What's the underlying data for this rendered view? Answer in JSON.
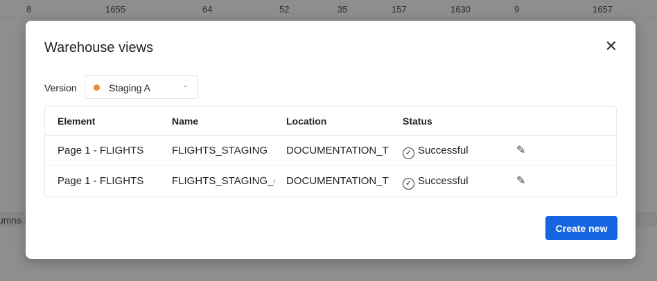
{
  "background": {
    "row_values": [
      "8",
      "1655",
      "64",
      "52",
      "35",
      "157",
      "1630",
      "9",
      "1657"
    ],
    "footer_text": "lumns"
  },
  "modal": {
    "title": "Warehouse views",
    "version_label": "Version",
    "version_value": "Staging A",
    "version_color": "#e8893a",
    "columns": [
      "Element",
      "Name",
      "Location",
      "Status"
    ],
    "rows": [
      {
        "element": "Page 1 - FLIGHTS",
        "name": "FLIGHTS_STAGING",
        "location": "DOCUMENTATION_T",
        "status": "Successful"
      },
      {
        "element": "Page 1 - FLIGHTS",
        "name": "FLIGHTS_STAGING_(",
        "location": "DOCUMENTATION_T",
        "status": "Successful"
      }
    ],
    "create_label": "Create new"
  }
}
